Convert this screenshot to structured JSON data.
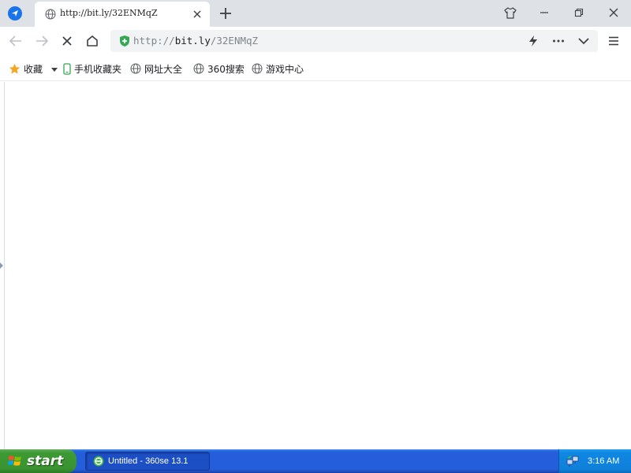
{
  "browser": {
    "tab": {
      "title": "http://bit.ly/32ENMqZ"
    },
    "address": {
      "scheme": "http://",
      "host": "bit.ly",
      "path": "/32ENMqZ"
    }
  },
  "bookmarks": [
    {
      "label": "收藏",
      "icon": "star-icon"
    },
    {
      "label": "手机收藏夹",
      "icon": "mobile-icon"
    },
    {
      "label": "网址大全",
      "icon": "globe-icon"
    },
    {
      "label": "360搜索",
      "icon": "globe-icon"
    },
    {
      "label": "游戏中心",
      "icon": "globe-icon"
    }
  ],
  "taskbar": {
    "start_label": "start",
    "task_item": "Untitled - 360se 13.1",
    "clock": "3:16 AM"
  },
  "colors": {
    "accent": "#1a73e8",
    "secure": "#34a853",
    "star": "#f5a623",
    "taskbar": "#245edb",
    "start": "#3c9a34"
  }
}
